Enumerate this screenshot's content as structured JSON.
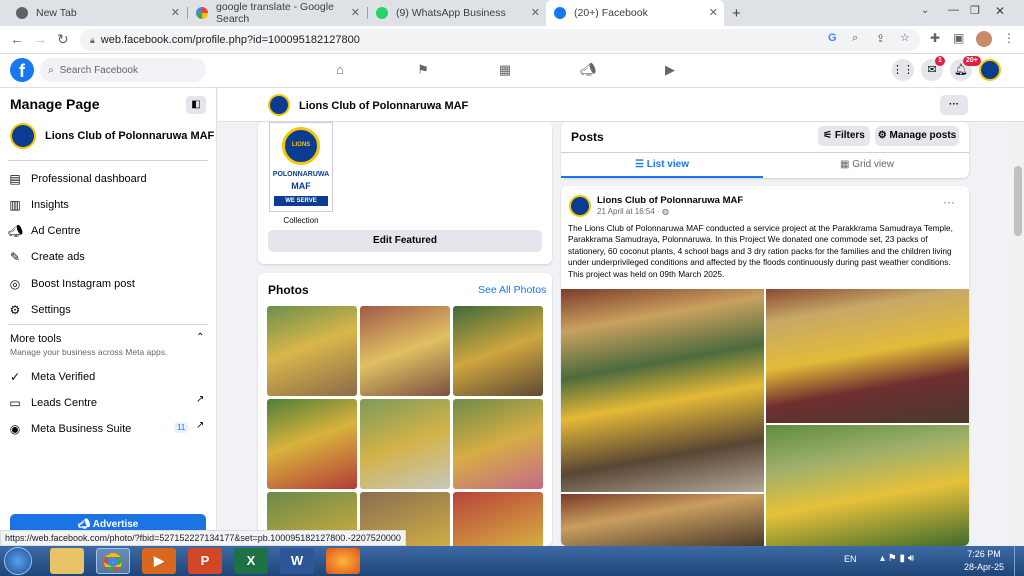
{
  "browser": {
    "tabs": [
      {
        "title": "New Tab"
      },
      {
        "title": "google translate - Google Search"
      },
      {
        "title": "(9) WhatsApp Business"
      },
      {
        "title": "(20+) Facebook"
      }
    ],
    "url": "web.facebook.com/profile.php?id=100095182127800",
    "status_url": "https://web.facebook.com/photo/?fbid=527152227134177&set=pb.100095182127800.-2207520000"
  },
  "fb": {
    "search_placeholder": "Search Facebook",
    "notifications_badge": "20+",
    "messenger_badge": "1"
  },
  "sidebar": {
    "title": "Manage Page",
    "page_name": "Lions Club of Polonnaruwa MAF",
    "items": [
      {
        "label": "Professional dashboard",
        "icon": "dashboard-icon"
      },
      {
        "label": "Insights",
        "icon": "insights-icon"
      },
      {
        "label": "Ad Centre",
        "icon": "megaphone-icon"
      },
      {
        "label": "Create ads",
        "icon": "pencil-icon"
      },
      {
        "label": "Boost Instagram post",
        "icon": "instagram-icon"
      },
      {
        "label": "Settings",
        "icon": "gear-icon"
      }
    ],
    "more_tools_title": "More tools",
    "more_tools_sub": "Manage your business across Meta apps.",
    "tools": [
      {
        "label": "Meta Verified",
        "icon": "verified-icon"
      },
      {
        "label": "Leads Centre",
        "icon": "leads-icon"
      },
      {
        "label": "Meta Business Suite",
        "icon": "business-suite-icon",
        "badge": "11"
      }
    ],
    "advertise_label": "Advertise"
  },
  "header": {
    "page_name": "Lions Club of Polonnaruwa MAF",
    "more_label": "···"
  },
  "featured": {
    "logo_top": "LIONS",
    "logo_mid1": "POLONNARUWA",
    "logo_mid2": "MAF",
    "logo_ribbon": "WE SERVE",
    "collection_label": "Collection",
    "edit_label": "Edit Featured"
  },
  "photos": {
    "title": "Photos",
    "see_all": "See All Photos"
  },
  "posts": {
    "title": "Posts",
    "filters_label": "Filters",
    "manage_label": "Manage posts",
    "list_view": "List view",
    "grid_view": "Grid view"
  },
  "post": {
    "author": "Lions Club of Polonnaruwa MAF",
    "date": "21 April at 16:54 ·",
    "text": "The Lions Club of Polonnaruwa MAF conducted a service project at the Parakkrama Samudraya Temple, Parakkrama Samudraya, Polonnaruwa. In this Project We donated one commode set, 23 packs of stationery, 60 coconut plants, 4 school bags and 3 dry ration packs for the families and the children living under underprivileged conditions and affected by the floods continuously during past weather conditions. This project was held on 09th March 2025."
  },
  "taskbar": {
    "lang": "EN",
    "time": "7:26 PM",
    "date": "28-Apr-25"
  },
  "colors": {
    "fb_blue": "#1877f2",
    "taskbar": "#1f4577"
  }
}
